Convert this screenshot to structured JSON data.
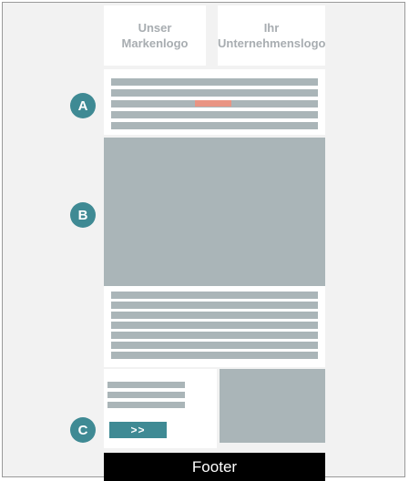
{
  "colors": {
    "accent_teal": "#3f8a94",
    "placeholder_gray": "#aab5b8",
    "highlight_coral": "#e99483",
    "footer_black": "#000000"
  },
  "header": {
    "logo_left": {
      "line1": "Unser",
      "line2": "Markenlogo"
    },
    "logo_right": {
      "line1": "Ihr",
      "line2": "Unternehmenslogo"
    }
  },
  "markers": {
    "a": "A",
    "b": "B",
    "c": "C"
  },
  "cta": {
    "label": ">>"
  },
  "footer": {
    "label": "Footer"
  }
}
